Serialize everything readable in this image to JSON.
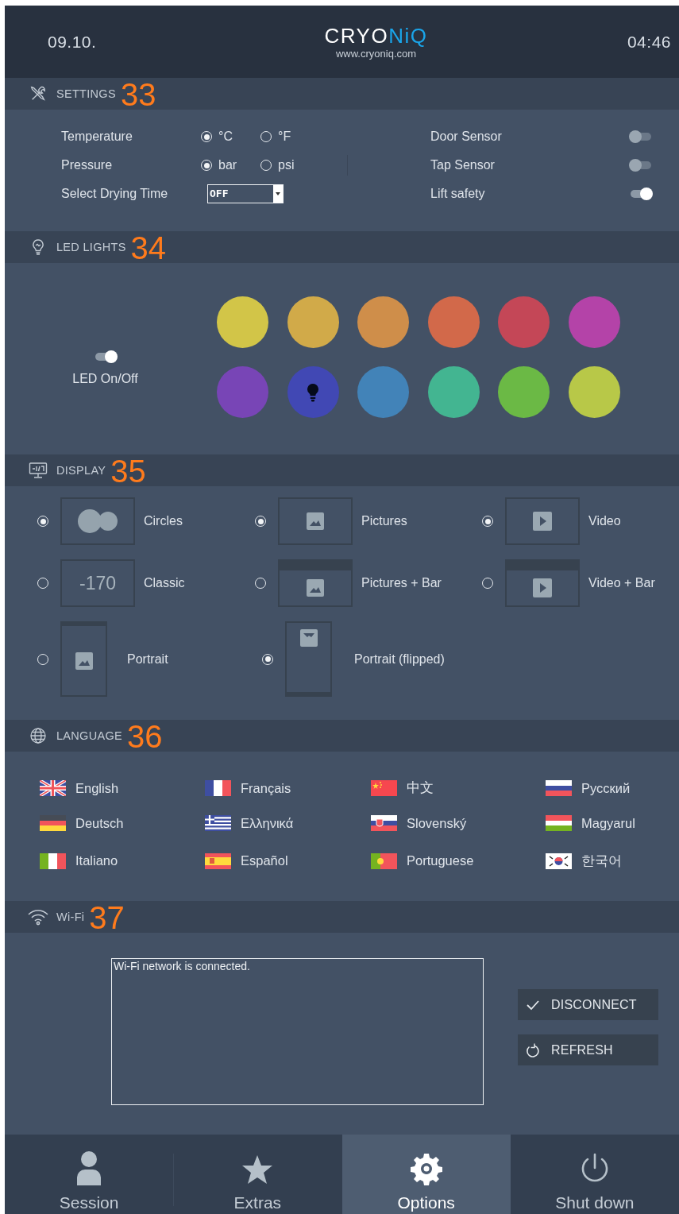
{
  "header": {
    "date": "09.10.",
    "logo": {
      "main": "CRYO",
      "accent": "NiQ"
    },
    "url": "www.cryoniq.com",
    "time": "04:46"
  },
  "settings": {
    "title": "SETTINGS",
    "annotation": "33",
    "rows": [
      {
        "label": "Temperature",
        "kind": "radio",
        "options": [
          {
            "label": "°C",
            "selected": true
          },
          {
            "label": "°F",
            "selected": false
          }
        ]
      },
      {
        "label": "Pressure",
        "kind": "radio",
        "options": [
          {
            "label": "bar",
            "selected": true
          },
          {
            "label": "psi",
            "selected": false
          }
        ]
      },
      {
        "label": "Select Drying Time",
        "kind": "dropdown",
        "value": "OFF"
      }
    ],
    "toggles": [
      {
        "label": "Door Sensor",
        "on": false
      },
      {
        "label": "Tap Sensor",
        "on": false
      },
      {
        "label": "Lift safety",
        "on": true
      }
    ]
  },
  "led_lights": {
    "title": "LED LIGHTS",
    "annotation": "34",
    "toggle": {
      "label": "LED On/Off",
      "on": true
    },
    "colors": [
      {
        "color": "#d2c548",
        "selected": false
      },
      {
        "color": "#d1aa49",
        "selected": false
      },
      {
        "color": "#cf8e4a",
        "selected": false
      },
      {
        "color": "#d2694a",
        "selected": false
      },
      {
        "color": "#c44757",
        "selected": false
      },
      {
        "color": "#b443a8",
        "selected": false
      },
      {
        "color": "#7845b6",
        "selected": false
      },
      {
        "color": "#4148b4",
        "selected": true
      },
      {
        "color": "#4283b8",
        "selected": false
      },
      {
        "color": "#43b591",
        "selected": false
      },
      {
        "color": "#6bb945",
        "selected": false
      },
      {
        "color": "#b8c848",
        "selected": false
      }
    ]
  },
  "display": {
    "title": "DISPLAY",
    "annotation": "35",
    "options": [
      {
        "label": "Circles",
        "kind": "circles",
        "selected": true
      },
      {
        "label": "Pictures",
        "kind": "pictures",
        "selected": true
      },
      {
        "label": "Video",
        "kind": "video",
        "selected": true
      },
      {
        "label": "Classic",
        "kind": "classic",
        "preview_text": "-170",
        "selected": false
      },
      {
        "label": "Pictures + Bar",
        "kind": "picturesbar",
        "selected": false
      },
      {
        "label": "Video + Bar",
        "kind": "videobar",
        "selected": false
      },
      {
        "label": "Portrait",
        "kind": "portrait",
        "selected": false
      },
      {
        "label": "Portrait (flipped)",
        "kind": "flipped",
        "selected": true
      }
    ]
  },
  "language": {
    "title": "LANGUAGE",
    "annotation": "36",
    "languages": [
      {
        "label": "English",
        "kind": "gb"
      },
      {
        "label": "Français",
        "kind": "fr"
      },
      {
        "label": "中文",
        "kind": "cn"
      },
      {
        "label": "Русский",
        "kind": "ru"
      },
      {
        "label": "Deutsch",
        "kind": "de"
      },
      {
        "label": "Ελληνικά",
        "kind": "gr"
      },
      {
        "label": "Slovenský",
        "kind": "sk"
      },
      {
        "label": "Magyarul",
        "kind": "hu"
      },
      {
        "label": "Italiano",
        "kind": "it"
      },
      {
        "label": "Español",
        "kind": "es"
      },
      {
        "label": "Portuguese",
        "kind": "pt"
      },
      {
        "label": "한국어",
        "kind": "kr"
      }
    ]
  },
  "wifi": {
    "title": "Wi-Fi",
    "annotation": "37",
    "status_text": "Wi-Fi network is connected.",
    "buttons": [
      {
        "label": "DISCONNECT",
        "kind": "check"
      },
      {
        "label": "REFRESH",
        "kind": "refresh"
      }
    ]
  },
  "nav": [
    {
      "label": "Session",
      "kind": "person",
      "selected": false
    },
    {
      "label": "Extras",
      "kind": "star",
      "selected": false
    },
    {
      "label": "Options",
      "kind": "gear",
      "selected": true
    },
    {
      "label": "Shut down",
      "kind": "power",
      "selected": false
    }
  ]
}
